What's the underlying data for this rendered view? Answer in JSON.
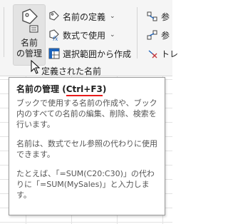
{
  "ribbon": {
    "name_manager": {
      "line1": "名前",
      "line2": "の管理"
    },
    "define_name": "名前の定義",
    "use_in_formula": "数式で使用",
    "create_from_selection": "選択範囲から作成",
    "defined_names_group": "定義された名前",
    "right_cmd1": "参",
    "right_cmd2": "参",
    "right_cmd3": "トレ"
  },
  "tooltip": {
    "title": "名前の管理",
    "open_paren": "(",
    "shortcut": "Ctrl+F3",
    "close_paren": ")",
    "para1": "ブックで使用する名前の作成や、ブック内のすべての名前の編集、削除、検索を行います。",
    "para2": "名前は、数式でセル参照の代わりに使用できます。",
    "para3": "たとえば、「=SUM(C20:C30)」の代わりに「=SUM(MySales)」と入力します。"
  },
  "colors": {
    "accent_underline": "#e81b1b",
    "icon_blue": "#1c62b9",
    "icon_red": "#c8373b"
  },
  "icons": [
    "name-manager-icon",
    "tag-icon",
    "formula-icon",
    "selection-grid-icon",
    "mouse-pointer-icon",
    "trace-arrow-icon"
  ]
}
